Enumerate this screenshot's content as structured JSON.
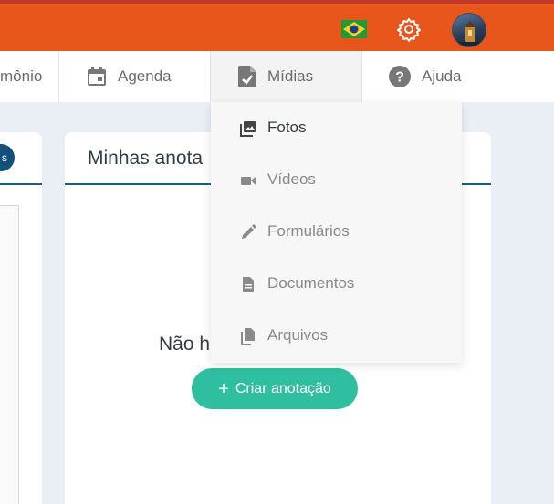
{
  "topbar": {
    "brand_color": "#e8561c",
    "flag_icon": "brazil-flag-icon",
    "settings_icon": "gear-icon",
    "avatar_icon": "user-avatar"
  },
  "nav": {
    "items": [
      {
        "label": "mônio",
        "icon": ""
      },
      {
        "label": "Agenda",
        "icon": "calendar-icon"
      },
      {
        "label": "Mídias",
        "icon": "file-check-icon"
      },
      {
        "label": "Ajuda",
        "icon": "help-circle-icon"
      }
    ]
  },
  "dropdown": {
    "items": [
      {
        "label": "Fotos",
        "icon": "photo-icon"
      },
      {
        "label": "Vídeos",
        "icon": "video-icon"
      },
      {
        "label": "Formulários",
        "icon": "pencil-icon"
      },
      {
        "label": "Documentos",
        "icon": "document-icon"
      },
      {
        "label": "Arquivos",
        "icon": "files-icon"
      }
    ]
  },
  "left_card": {
    "pill_text": "s"
  },
  "main_card": {
    "title": "Minhas anota",
    "empty_text": "Não h",
    "create_button": "Criar anotação",
    "create_button_color": "#2fbfa0"
  }
}
